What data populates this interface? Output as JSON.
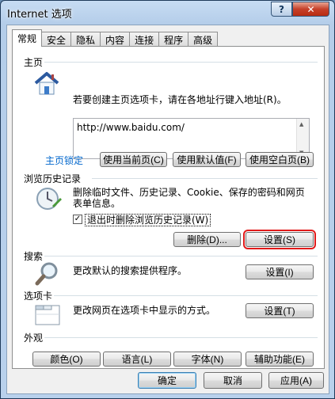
{
  "window": {
    "title": "Internet 选项",
    "help_glyph": "?",
    "close_glyph": "✕"
  },
  "tabs": [
    "常规",
    "安全",
    "隐私",
    "内容",
    "连接",
    "程序",
    "高级"
  ],
  "home": {
    "title": "主页",
    "description": "若要创建主页选项卡，请在各地址行键入地址(R)。",
    "url": "http://www.baidu.com/",
    "locked_link": "主页锁定",
    "use_current": "使用当前页(C)",
    "use_default": "使用默认值(F)",
    "use_blank": "使用空白页(B)"
  },
  "history": {
    "title": "浏览历史记录",
    "description": "删除临时文件、历史记录、Cookie、保存的密码和网页表单信息。",
    "checkbox_label": "退出时删除浏览历史记录(W)",
    "checkbox_mark": "✓",
    "delete_button": "删除(D)...",
    "settings_button": "设置(S)"
  },
  "search": {
    "title": "搜索",
    "description": "更改默认的搜索提供程序。",
    "settings_button": "设置(I)"
  },
  "tabs_section": {
    "title": "选项卡",
    "description": "更改网页在选项卡中显示的方式。",
    "settings_button": "设置(T)"
  },
  "appearance": {
    "title": "外观",
    "colors": "颜色(O)",
    "languages": "语言(L)",
    "fonts": "字体(N)",
    "accessibility": "辅助功能(E)"
  },
  "footer": {
    "ok": "确定",
    "cancel": "取消",
    "apply": "应用(A)"
  }
}
